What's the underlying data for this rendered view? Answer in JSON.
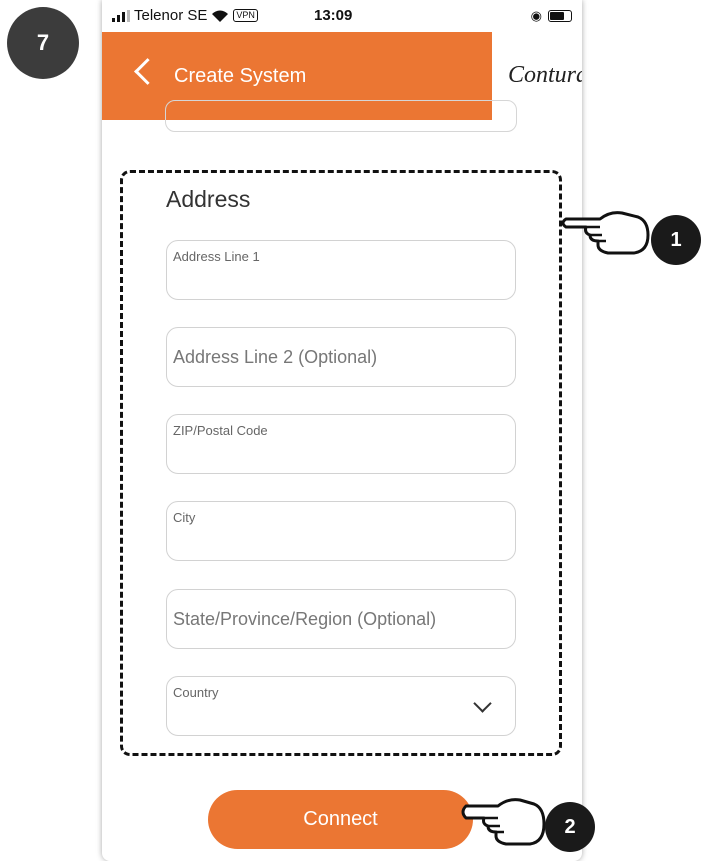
{
  "step_badge": "7",
  "status_bar": {
    "carrier": "Telenor SE",
    "vpn": "VPN",
    "time": "13:09"
  },
  "app_bar": {
    "title": "Create System",
    "logo": "Contura"
  },
  "address": {
    "heading": "Address",
    "fields": [
      {
        "label": "Address Line 1",
        "value": ""
      },
      {
        "placeholder": "Address Line 2 (Optional)"
      },
      {
        "label": "ZIP/Postal Code",
        "value": ""
      },
      {
        "label": "City",
        "value": ""
      },
      {
        "placeholder": "State/Province/Region (Optional)"
      },
      {
        "label": "Country",
        "value": ""
      }
    ]
  },
  "connect_button": "Connect",
  "callouts": {
    "address_section": "1",
    "connect": "2"
  }
}
